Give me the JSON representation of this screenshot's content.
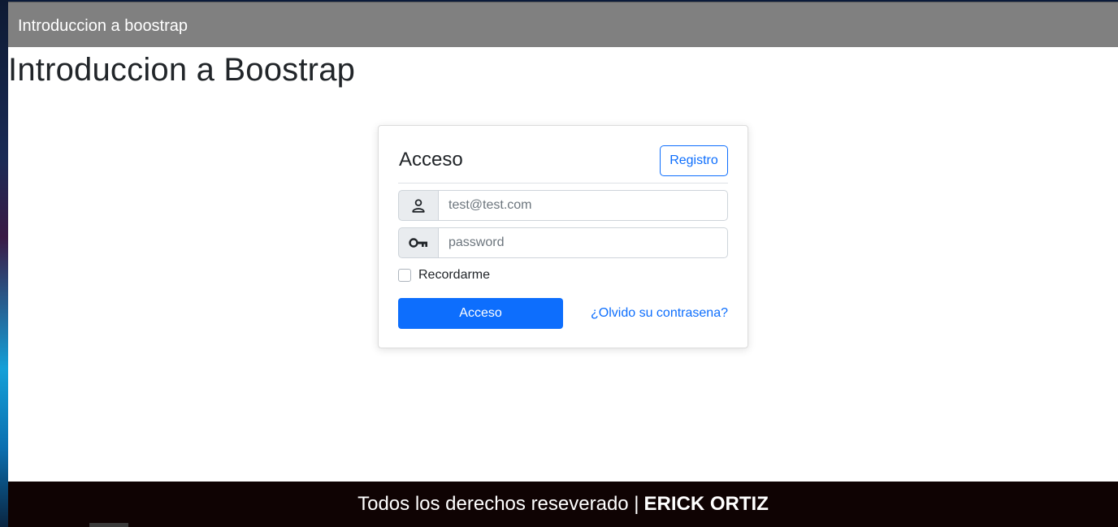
{
  "navbar": {
    "brand": "Introduccion a boostrap"
  },
  "page": {
    "title": "Introduccion a Boostrap"
  },
  "login": {
    "title": "Acceso",
    "register_label": "Registro",
    "email": {
      "value": "",
      "placeholder": "test@test.com",
      "icon": "user-icon"
    },
    "password": {
      "value": "",
      "placeholder": "password",
      "icon": "key-icon"
    },
    "remember_label": "Recordarme",
    "remember_checked": false,
    "submit_label": "Acceso",
    "forgot_label": "¿Olvido su contrasena?"
  },
  "footer": {
    "text": "Todos los derechos reseverado |",
    "author": "ERICK ORTIZ"
  },
  "colors": {
    "navbar_bg": "#808080",
    "primary": "#0d6efd",
    "footer_bg": "#0f0303"
  }
}
